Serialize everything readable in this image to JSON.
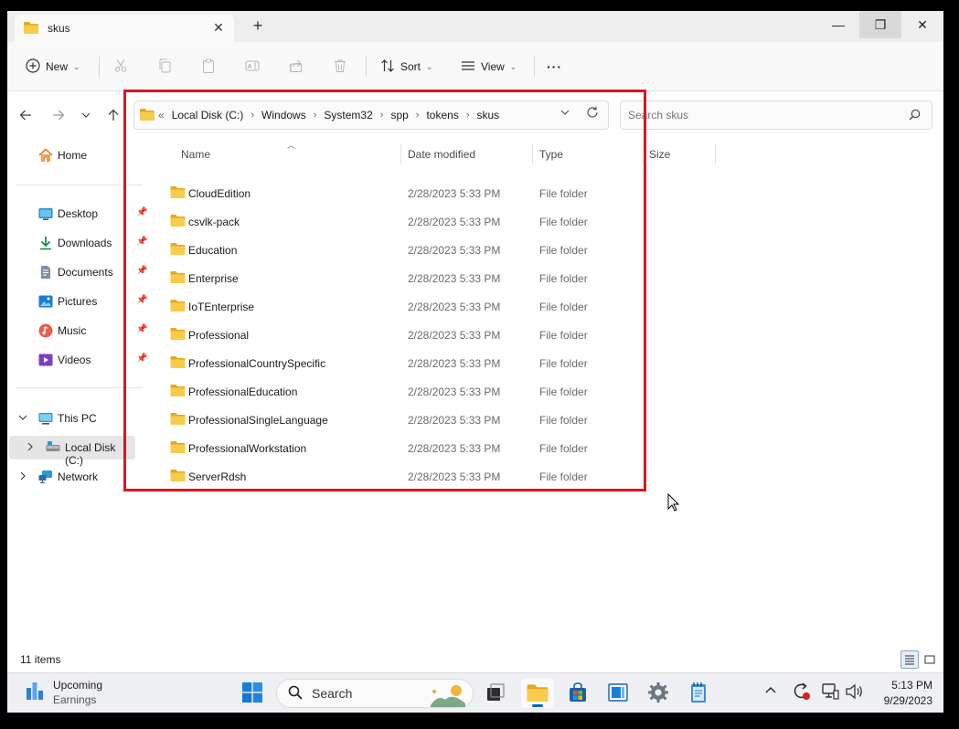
{
  "window": {
    "tab_title": "skus",
    "tab_close": "✕",
    "new_tab": "+",
    "minimize": "—",
    "maximize": "❐",
    "close": "✕"
  },
  "toolbar": {
    "new_label": "New",
    "sort_label": "Sort",
    "view_label": "View",
    "more_label": "···"
  },
  "address": {
    "overflow": "«",
    "breadcrumbs": [
      "Local Disk (C:)",
      "Windows",
      "System32",
      "spp",
      "tokens",
      "skus"
    ],
    "search_placeholder": "Search skus"
  },
  "sidebar": {
    "home": "Home",
    "quick_access": [
      {
        "label": "Desktop",
        "icon": "desktop-icon"
      },
      {
        "label": "Downloads",
        "icon": "download-icon"
      },
      {
        "label": "Documents",
        "icon": "documents-icon"
      },
      {
        "label": "Pictures",
        "icon": "pictures-icon"
      },
      {
        "label": "Music",
        "icon": "music-icon"
      },
      {
        "label": "Videos",
        "icon": "videos-icon"
      }
    ],
    "this_pc": "This PC",
    "local_disk": "Local Disk (C:)",
    "network": "Network"
  },
  "columns": {
    "name": "Name",
    "date": "Date modified",
    "type": "Type",
    "size": "Size"
  },
  "files": [
    {
      "name": "CloudEdition",
      "date": "2/28/2023 5:33 PM",
      "type": "File folder"
    },
    {
      "name": "csvlk-pack",
      "date": "2/28/2023 5:33 PM",
      "type": "File folder"
    },
    {
      "name": "Education",
      "date": "2/28/2023 5:33 PM",
      "type": "File folder"
    },
    {
      "name": "Enterprise",
      "date": "2/28/2023 5:33 PM",
      "type": "File folder"
    },
    {
      "name": "IoTEnterprise",
      "date": "2/28/2023 5:33 PM",
      "type": "File folder"
    },
    {
      "name": "Professional",
      "date": "2/28/2023 5:33 PM",
      "type": "File folder"
    },
    {
      "name": "ProfessionalCountrySpecific",
      "date": "2/28/2023 5:33 PM",
      "type": "File folder"
    },
    {
      "name": "ProfessionalEducation",
      "date": "2/28/2023 5:33 PM",
      "type": "File folder"
    },
    {
      "name": "ProfessionalSingleLanguage",
      "date": "2/28/2023 5:33 PM",
      "type": "File folder"
    },
    {
      "name": "ProfessionalWorkstation",
      "date": "2/28/2023 5:33 PM",
      "type": "File folder"
    },
    {
      "name": "ServerRdsh",
      "date": "2/28/2023 5:33 PM",
      "type": "File folder"
    }
  ],
  "status": {
    "item_count": "11 items"
  },
  "taskbar": {
    "widget_title": "Upcoming",
    "widget_subtitle": "Earnings",
    "search_label": "Search",
    "time": "5:13 PM",
    "date": "9/29/2023"
  },
  "colors": {
    "highlight": "#e0141e",
    "folder": "#f3c13a",
    "accent": "#0067c0"
  }
}
